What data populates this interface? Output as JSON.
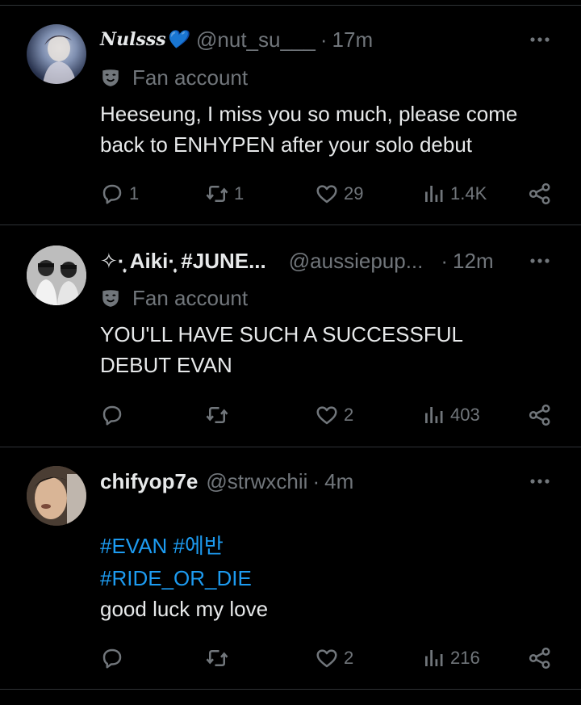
{
  "tweets": [
    {
      "name": "Nulsss💙",
      "handle": "@nut_su___",
      "dot": "·",
      "time": "17m",
      "badge": "Fan account",
      "text": "Heeseung, I miss you so much, please come\nback to ENHYPEN after your solo debut",
      "replies": "1",
      "reposts": "1",
      "likes": "29",
      "views": "1.4K"
    },
    {
      "name": "✧·̩͙ Aiki·̩͙ #JUNE...",
      "handle": "@aussiepup...",
      "dot": "·",
      "time": "12m",
      "badge": "Fan account",
      "text": "YOU'LL HAVE SUCH A SUCCESSFUL\nDEBUT EVAN",
      "replies": "",
      "reposts": "",
      "likes": "2",
      "views": "403"
    },
    {
      "name": "chifyop7e",
      "handle": "@strwxchii",
      "dot": "·",
      "time": "4m",
      "hashtags_line1": "#EVAN #에반",
      "hashtags_line2": "#RIDE_OR_DIE",
      "text": "good luck my love",
      "replies": "",
      "reposts": "",
      "likes": "2",
      "views": "216"
    }
  ],
  "colors": {
    "background": "#000000",
    "text": "#e7e9ea",
    "muted": "#71767b",
    "link": "#1d9bf0",
    "divider": "#2f3336",
    "heart_emoji": "#5fb1f5"
  },
  "icons": [
    "more-icon",
    "mask-icon",
    "reply-icon",
    "repost-icon",
    "like-icon",
    "views-icon",
    "share-icon"
  ]
}
